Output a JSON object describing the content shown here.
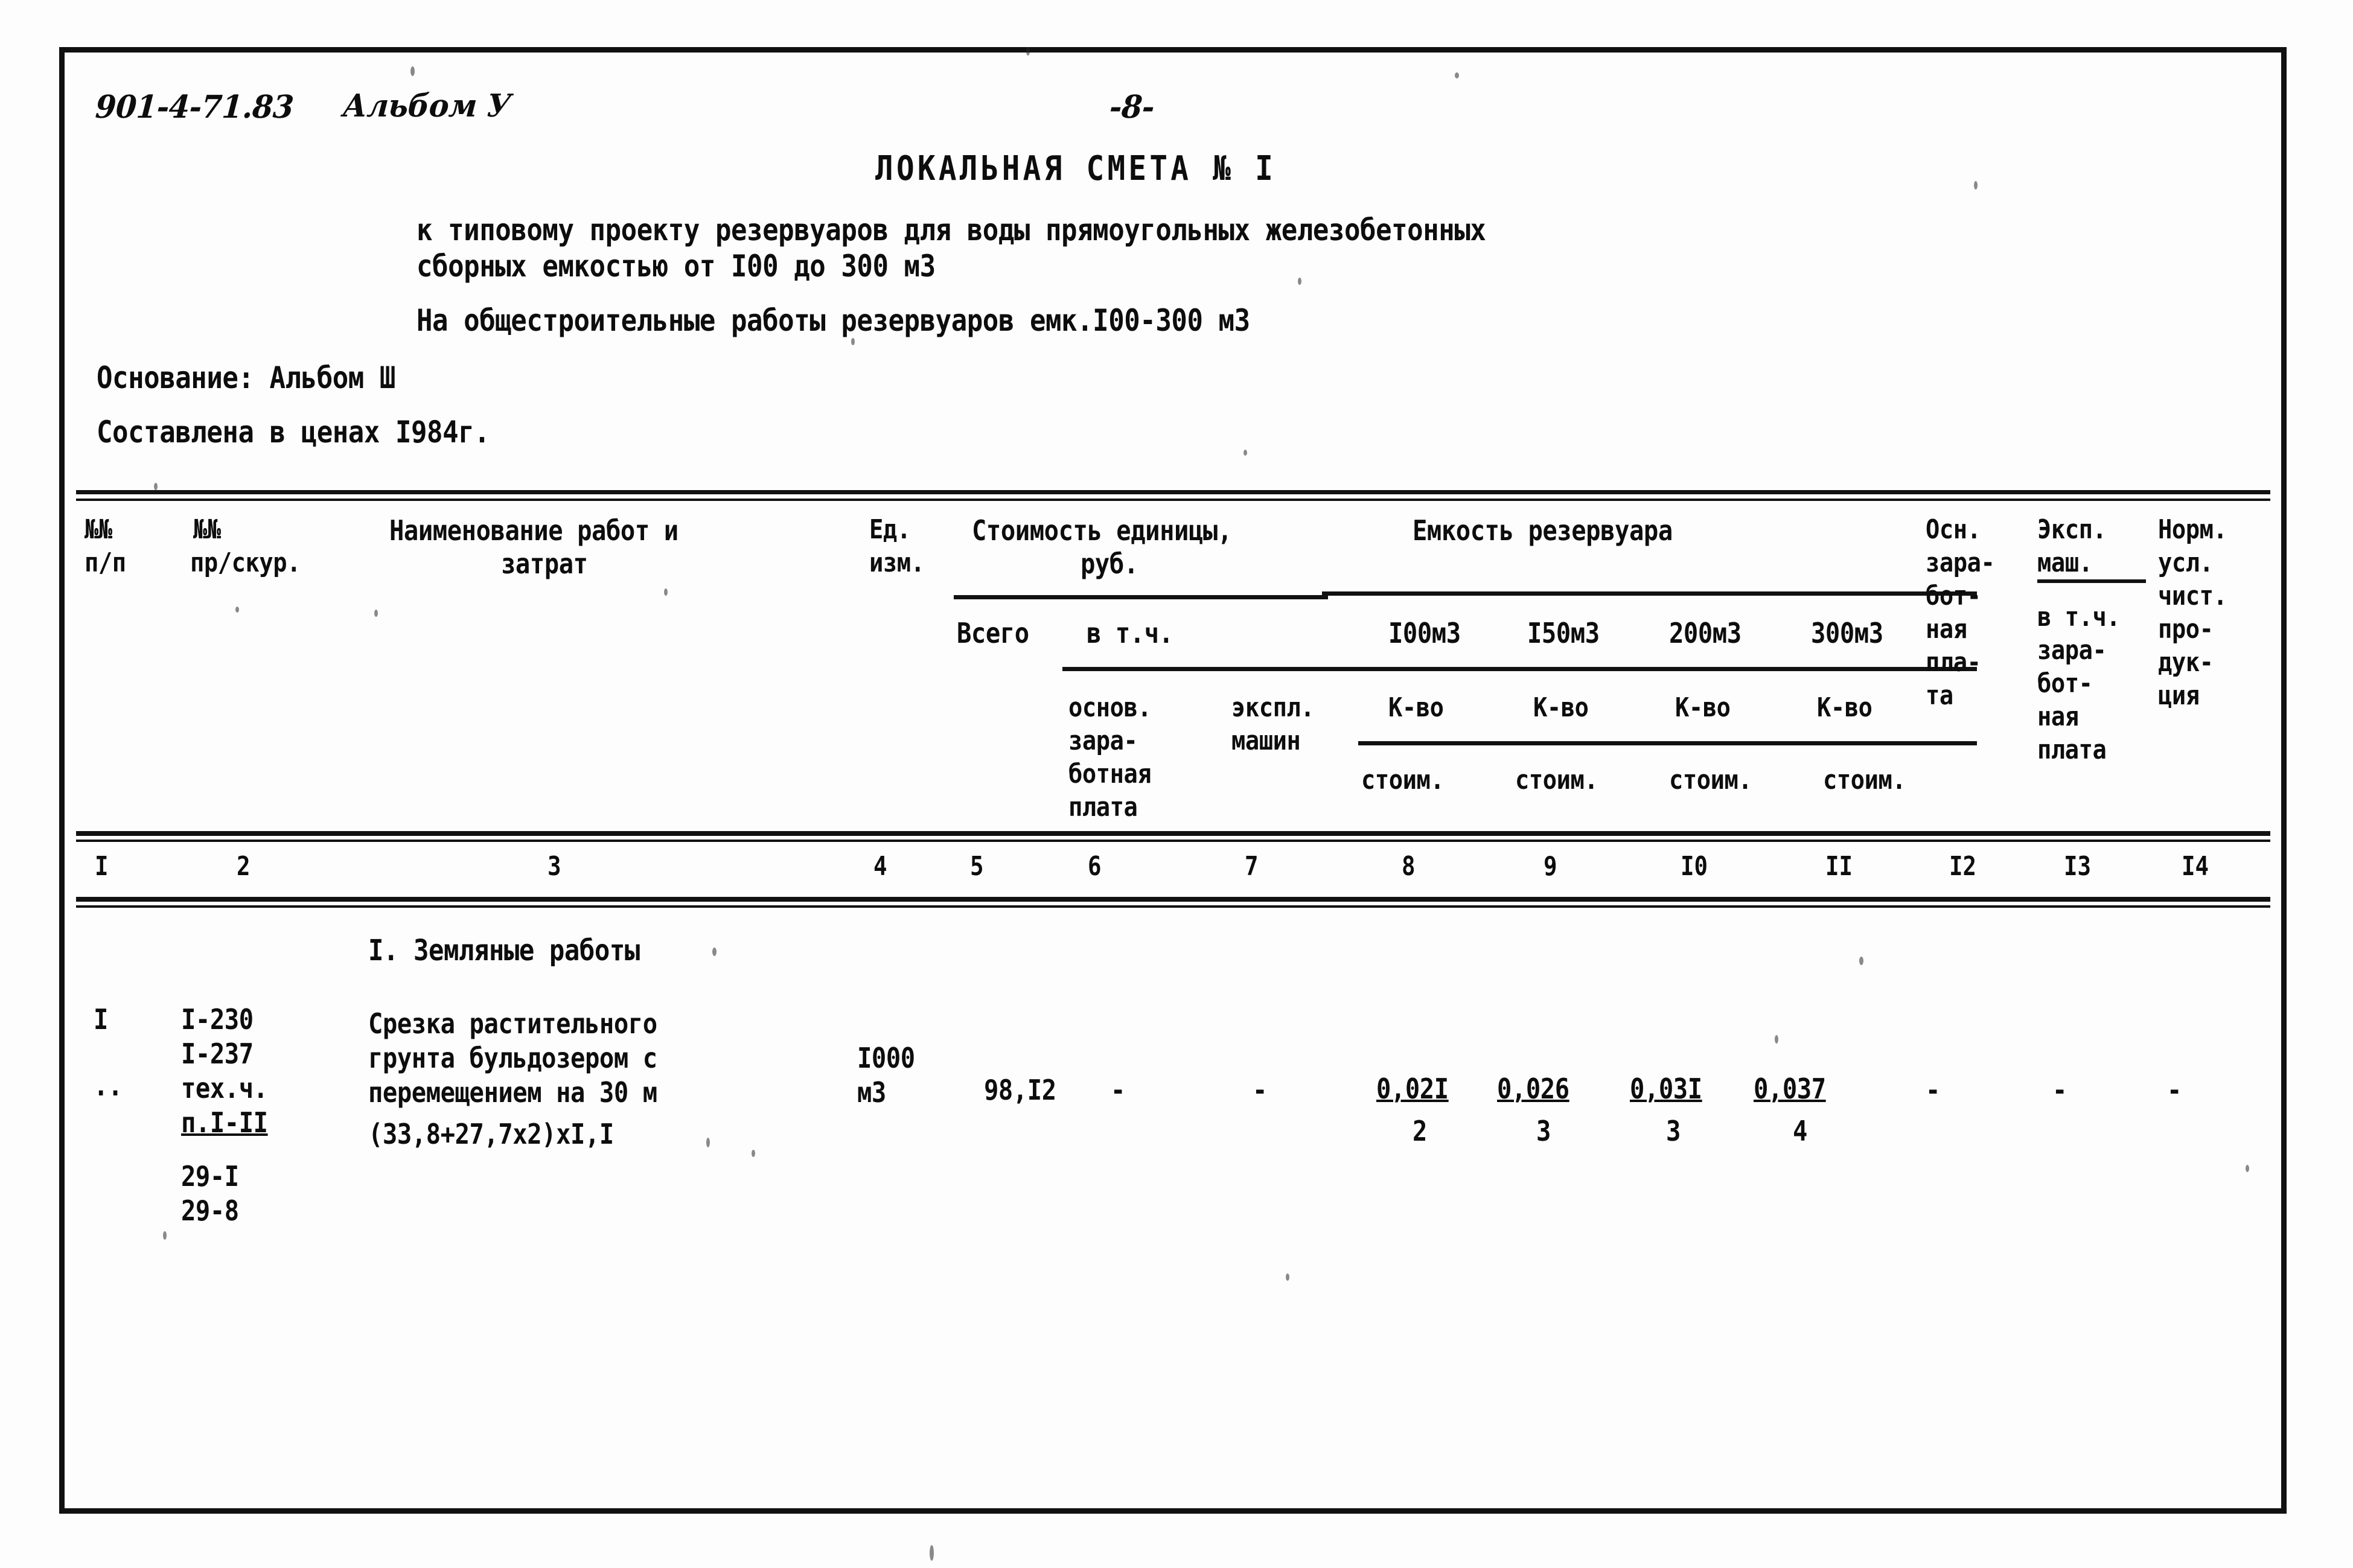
{
  "document": {
    "code": "901-4-71.83",
    "album": "Альбом У",
    "page_number": "-8-",
    "title": "ЛОКАЛЬНАЯ СМЕТА № I",
    "subtitle_line1": "к типовому проекту резервуаров для воды прямоугольных железобетонных",
    "subtitle_line2": "сборных емкостью от I00 до 300 м3",
    "subtitle_line3": "На общестроительные работы резервуаров емк.I00-300 м3",
    "basis": "Основание: Альбом Ш",
    "prices": "Составлена в ценах I984г."
  },
  "table": {
    "headers": {
      "c1_l1": "№№",
      "c1_l2": "п/п",
      "c2_l1": "№№",
      "c2_l2": "пр/скур.",
      "c3_l1": "Наименование работ и",
      "c3_l2": "затрат",
      "c4_l1": "Ед.",
      "c4_l2": "изм.",
      "cost_group_l1": "Стоимость единицы,",
      "cost_group_l2": "руб.",
      "capacity_group": "Емкость резервуара",
      "total": "Всего",
      "in_which": "в т.ч.",
      "basic_wage_l1": "основ.",
      "basic_wage_l2": "зара-",
      "basic_wage_l3": "ботная",
      "basic_wage_l4": "плата",
      "machines_l1": "экспл.",
      "machines_l2": "машин",
      "cap_100": "I00м3",
      "cap_150": "I50м3",
      "cap_200": "200м3",
      "cap_300": "300м3",
      "qty": "К-во",
      "cost": "стоим.",
      "c12_l1": "Осн.",
      "c12_l2": "зара-",
      "c12_l3": "бот-",
      "c12_l4": "ная",
      "c12_l5": "пла-",
      "c12_l6": "та",
      "c13_l1": "Эксп.",
      "c13_l2": "маш.",
      "c13_l3": "в т.ч.",
      "c13_l4": "зара-",
      "c13_l5": "бот-",
      "c13_l6": "ная",
      "c13_l7": "плата",
      "c14_l1": "Норм.",
      "c14_l2": "усл.",
      "c14_l3": "чист.",
      "c14_l4": "про-",
      "c14_l5": "дук-",
      "c14_l6": "ция"
    },
    "column_numbers": [
      "I",
      "2",
      "3",
      "4",
      "5",
      "6",
      "7",
      "8",
      "9",
      "I0",
      "II",
      "I2",
      "I3",
      "I4"
    ],
    "section_title": "I. Земляные работы",
    "row": {
      "num": "I",
      "num_continuation": "..",
      "codes": [
        "I-230",
        "I-237",
        "тех.ч.",
        "п.I-II",
        "29-I",
        "29-8"
      ],
      "code_underlined": "п.I-II",
      "desc_l1": "Срезка растительного",
      "desc_l2": "грунта бульдозером с",
      "desc_l3": "перемещением на 30 м",
      "desc_l4": "(33,8+27,7x2)xI,I",
      "unit_l1": "I000",
      "unit_l2": "м3",
      "total_cost": "98,I2",
      "basic_wage": "-",
      "machines": "-",
      "cap_100_qty": "0,02I",
      "cap_100_cost": "2",
      "cap_150_qty": "0,026",
      "cap_150_cost": "3",
      "cap_200_qty": "0,03I",
      "cap_200_cost": "3",
      "cap_300_qty": "0,037",
      "cap_300_cost": "4",
      "c12_value": "-",
      "c13_value": "-",
      "c14_value": "-"
    }
  }
}
